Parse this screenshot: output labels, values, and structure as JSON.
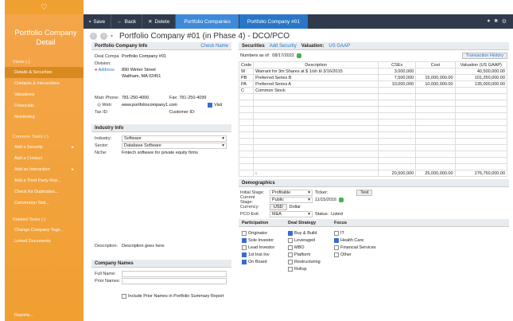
{
  "sidebar": {
    "title": "Portfolio Company Detail",
    "views_label": "Views (-)",
    "views": [
      "Details & Securities",
      "Contacts & Interactions",
      "Valuations",
      "Financials",
      "Monitoring"
    ],
    "common_label": "Common Tasks (-)",
    "common": [
      "Add a Security",
      "Add a Contact",
      "Add an Interaction",
      "Add a Third Party Rep...",
      "Check for Duplicates...",
      "Conversion Tool..."
    ],
    "related_label": "Related Tasks (-)",
    "related": [
      "Change Company Tags...",
      "Linked Documents"
    ],
    "bottom": "Reports..."
  },
  "toolbar": {
    "save": "Save",
    "back": "Back",
    "delete": "Delete",
    "tab1": "Portfolio Companies",
    "tab2": "Portfolio Company #01"
  },
  "title": "Portfolio Company #01 (in Phase 4) - DCO/PCO",
  "info": {
    "header": "Portfolio Company Info",
    "check_name": "Check Name",
    "deal_label": "Deal Compa",
    "deal_value": "Portfolio Company #01",
    "division_label": "Division:",
    "address_label": "Address",
    "address1": "890 Winter Street",
    "address2": "Waltham, MA  02451",
    "phone_label": "Main Phone:",
    "phone": "781-250-4000",
    "fax_label": "Fax:",
    "fax": "781-250-4099",
    "web_label": "Web:",
    "web": "www.portfoliocompany1.com",
    "visit": "Visit",
    "taxid_label": "Tax ID:",
    "customer_label": "Customer ID:"
  },
  "industry": {
    "header": "Industry Info",
    "industry_label": "Industry:",
    "industry": "Software",
    "sector_label": "Sector:",
    "sector": "Database Software",
    "niche_label": "Niche:",
    "niche": "Fintech software for private equity firms",
    "description_label": "Description:",
    "description": "Description goes here"
  },
  "names": {
    "header": "Company Names",
    "full_label": "Full Name:",
    "prior_label": "Prior Names:",
    "include": "Include Prior Names in Portfolio Summary Report"
  },
  "securities": {
    "tab": "Securities",
    "add": "Add Security",
    "valuation_label": "Valuation:",
    "valuation": "US GAAP",
    "numbers_label": "Numbers as of:",
    "numbers_date": "08/17/2022",
    "history": "Transaction History",
    "columns": [
      "Code",
      "Description",
      "CSEs",
      "Cost",
      "Valuation (US GAAP)"
    ],
    "rows": [
      [
        "W",
        "Warrant for 3m Shares at $ 1/sh til 3/16/2015",
        "3,000,000",
        "",
        "40,500,000.00"
      ],
      [
        "PB",
        "Preferred Series B",
        "7,500,000",
        "15,000,000.00",
        "101,250,000.00"
      ],
      [
        "PA",
        "Preferred Series A",
        "10,000,000",
        "10,000,000.00",
        "135,000,000.00"
      ],
      [
        "C",
        "Common Stock",
        "",
        "",
        ""
      ]
    ],
    "totals": [
      "20,500,000",
      "25,000,000.00",
      "276,750,000.00"
    ]
  },
  "demographics": {
    "header": "Demographics",
    "initial_label": "Initial Stage:",
    "initial": "Profitable",
    "ticker_label": "Ticker:",
    "test": "Test",
    "current_label": "Current Stage:",
    "current": "Public",
    "current_date": "11/15/2016",
    "currency_label": "Currency:",
    "currency_code": "USD",
    "currency": "Dollar",
    "pco_label": "PCO Exit:",
    "pco": "M&A",
    "status_label": "Status:",
    "status": "Listed"
  },
  "tags": {
    "participation_label": "Participation",
    "deal_label": "Deal Strategy",
    "focus_label": "Focus",
    "participation": [
      {
        "l": "Originator",
        "c": false
      },
      {
        "l": "Sole Investor",
        "c": true
      },
      {
        "l": "Lead Investor",
        "c": false
      },
      {
        "l": "1st Inst Inv",
        "c": true
      },
      {
        "l": "On Board",
        "c": true
      }
    ],
    "deal": [
      {
        "l": "Buy & Build",
        "c": true
      },
      {
        "l": "Leveraged",
        "c": false
      },
      {
        "l": "MBO",
        "c": false
      },
      {
        "l": "Platform",
        "c": false
      },
      {
        "l": "Restructuring",
        "c": false
      },
      {
        "l": "Rollup",
        "c": false
      }
    ],
    "focus": [
      {
        "l": "IT",
        "c": false
      },
      {
        "l": "Health Care",
        "c": true
      },
      {
        "l": "Financial Services",
        "c": false
      },
      {
        "l": "Other",
        "c": false
      }
    ]
  }
}
